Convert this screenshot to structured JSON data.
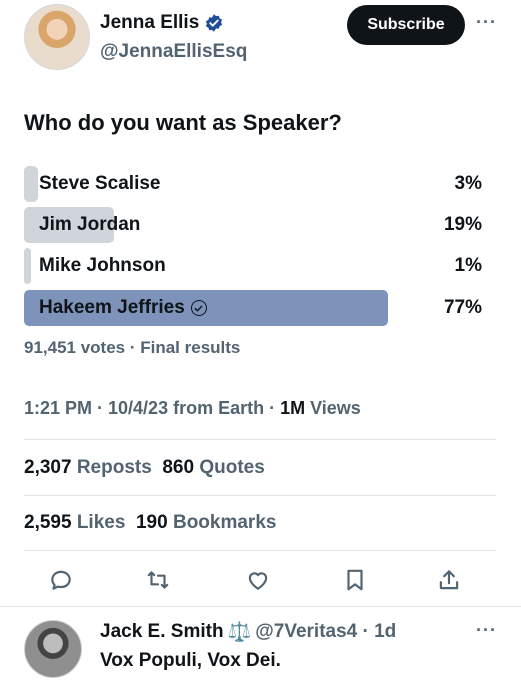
{
  "author": {
    "display_name": "Jenna Ellis",
    "handle": "@JennaEllisEsq",
    "verified_icon": "verified-badge-icon",
    "subscribe_label": "Subscribe",
    "more_label": "···"
  },
  "poll": {
    "question": "Who do you want as Speaker?",
    "options": [
      {
        "label": "Steve Scalise",
        "percent_text": "3%",
        "percent": 3,
        "selected": false
      },
      {
        "label": "Jim Jordan",
        "percent_text": "19%",
        "percent": 19,
        "selected": false
      },
      {
        "label": "Mike Johnson",
        "percent_text": "1%",
        "percent": 1,
        "selected": false
      },
      {
        "label": "Hakeem Jeffries",
        "percent_text": "77%",
        "percent": 77,
        "selected": true
      }
    ],
    "results_text": "91,451 votes · Final results"
  },
  "meta": {
    "time_text": "1:21 PM · 10/4/23 from Earth · ",
    "views_count": "1M",
    "views_label": " Views"
  },
  "stats": {
    "reposts_count": "2,307",
    "reposts_label": " Reposts",
    "quotes_count": "860",
    "quotes_label": " Quotes",
    "likes_count": "2,595",
    "likes_label": " Likes",
    "bookmarks_count": "190",
    "bookmarks_label": " Bookmarks"
  },
  "reply": {
    "display_name": "Jack E. Smith",
    "scales_glyph": "⚖️",
    "handle_time": "@7Veritas4 · 1d",
    "text": "Vox Populi, Vox Dei.",
    "more_label": "···"
  },
  "colors": {
    "winning_bar": "#7d93b9",
    "losing_bar": "#cfd5db",
    "subscribe_bg": "#0f1419",
    "muted_text": "#536471"
  }
}
